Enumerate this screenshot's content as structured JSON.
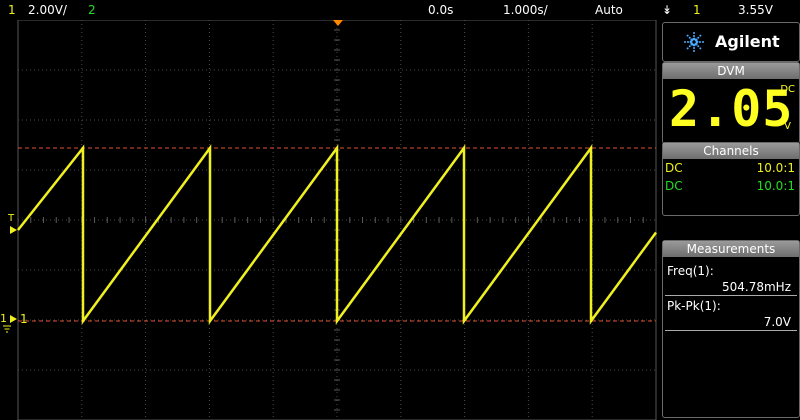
{
  "header": {
    "ch1_number": "1",
    "ch1_scale": "2.00V/",
    "ch2_number": "2",
    "time_ref": "0.0s",
    "time_scale": "1.000s/",
    "trigger_mode": "Auto",
    "trigger_source": "1",
    "trigger_level": "3.55V"
  },
  "brand": {
    "name": "Agilent"
  },
  "dvm": {
    "title": "DVM",
    "value": "2.05",
    "coupling": "DC",
    "unit": "V"
  },
  "channels": {
    "title": "Channels",
    "items": [
      {
        "coupling": "DC",
        "probe": "10.0:1",
        "color": "#f0f020"
      },
      {
        "coupling": "DC",
        "probe": "10.0:1",
        "color": "#22dd22"
      }
    ]
  },
  "measurements": {
    "title": "Measurements",
    "items": [
      {
        "label": "Freq(1):",
        "value": "504.78mHz"
      },
      {
        "label": "Pk-Pk(1):",
        "value": "7.0V"
      }
    ]
  },
  "markers": {
    "trigger_T": "T",
    "ground_label": "1",
    "ground_sub": "1"
  },
  "colors": {
    "ch1": "#f0f020",
    "ch2": "#22dd22",
    "grid": "#3a3a3a",
    "cursor": "#e05030",
    "trigger": "#ff8800"
  }
}
